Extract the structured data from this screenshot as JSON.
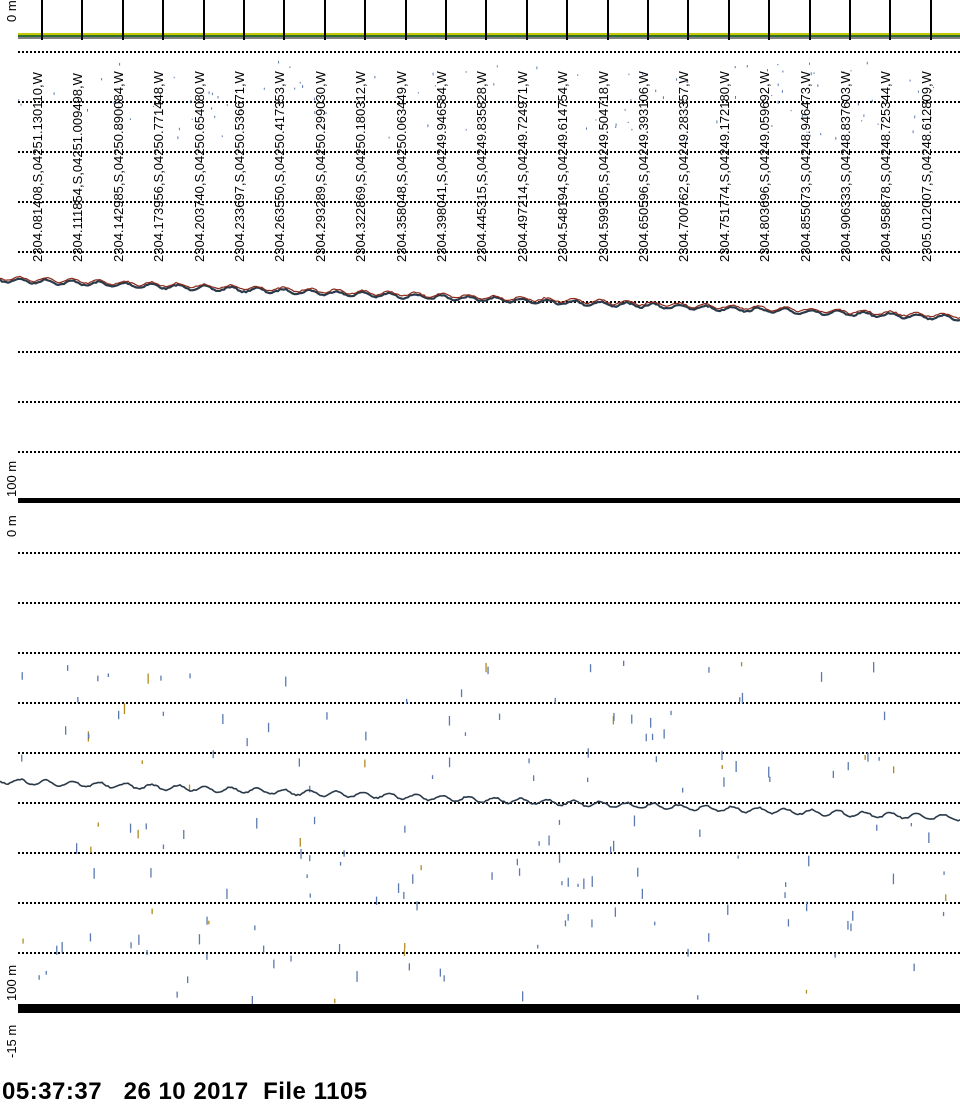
{
  "panels": [
    {
      "name": "upper",
      "depth_top_label": "0 m",
      "depth_bottom_label": "100 m"
    },
    {
      "name": "lower",
      "depth_top_label": "0 m",
      "depth_bottom_label": "100 m",
      "offset_label": "-15 m"
    }
  ],
  "positions": [
    "2304.081408,S,04251.130110,W",
    "2304.111854,S,04251.009498,W",
    "2304.142985,S,04250.890084,W",
    "2304.173956,S,04250.771448,W",
    "2304.203740,S,04250.654080,W",
    "2304.233697,S,04250.536671,W",
    "2304.263550,S,04250.417353,W",
    "2304.293289,S,04250.299030,W",
    "2304.322869,S,04250.180312,W",
    "2304.358048,S,04250.063449,W",
    "2304.398041,S,04249.946584,W",
    "2304.445315,S,04249.835828,W",
    "2304.497214,S,04249.724971,W",
    "2304.548194,S,04249.614754,W",
    "2304.599305,S,04249.504718,W",
    "2304.650596,S,04249.393106,W",
    "2304.700762,S,04249.283357,W",
    "2304.751774,S,04249.172180,W",
    "2304.803696,S,04249.059692,W",
    "2304.855073,S,04248.946473,W",
    "2304.906333,S,04248.837603,W",
    "2304.958878,S,04248.725344,W",
    "2305.012007,S,04248.612809,W"
  ],
  "footer": {
    "time": "05:37:37",
    "date": "26 10 2017",
    "file": "File 1105"
  },
  "colors": {
    "grid": "#000000",
    "surface_band_yellow": "#c8c800",
    "surface_band_green": "#2e6e2e",
    "bottom_trace_red": "#8b2a1a",
    "bottom_trace_dark": "#2a3a4a",
    "speckle_blue": "#5a7ab0"
  }
}
